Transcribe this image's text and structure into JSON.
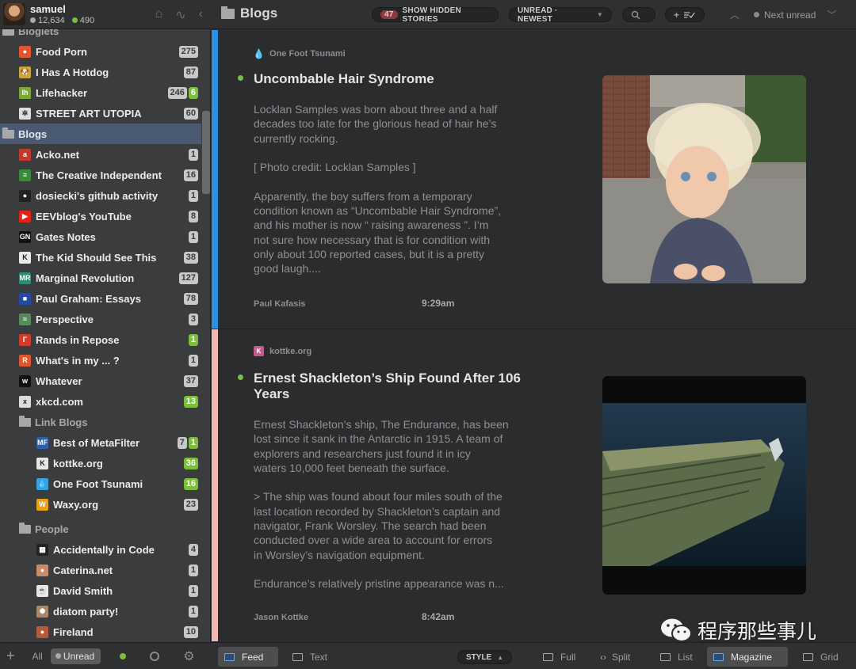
{
  "profile": {
    "name": "samuel",
    "stat_primary": "12,634",
    "stat_secondary": "490"
  },
  "sidebar": {
    "partial_folder": "Blogiets",
    "feeds_top": [
      {
        "title": "Food Porn",
        "counts": [
          {
            "v": "275",
            "k": "g"
          }
        ],
        "fav": "#e4552b",
        "glyph": "●"
      },
      {
        "title": "I Has A Hotdog",
        "counts": [
          {
            "v": "87",
            "k": "g"
          }
        ],
        "fav": "#c9a53a",
        "glyph": "🐶"
      },
      {
        "title": "Lifehacker",
        "counts": [
          {
            "v": "246",
            "k": "g"
          },
          {
            "v": "6",
            "k": "n"
          }
        ],
        "fav": "#7aa83a",
        "glyph": "lh"
      },
      {
        "title": "STREET ART UTOPIA",
        "counts": [
          {
            "v": "60",
            "k": "g"
          }
        ],
        "fav": "#dddddd",
        "glyph": "✲"
      }
    ],
    "blogs_folder": "Blogs",
    "feeds_blogs": [
      {
        "title": "Acko.net",
        "counts": [
          {
            "v": "1",
            "k": "g"
          }
        ],
        "fav": "#c0392b",
        "glyph": "a"
      },
      {
        "title": "The Creative Independent",
        "counts": [
          {
            "v": "16",
            "k": "g"
          }
        ],
        "fav": "#3a8a3a",
        "glyph": "≡"
      },
      {
        "title": "dosiecki's github activity",
        "counts": [
          {
            "v": "1",
            "k": "g"
          }
        ],
        "fav": "#222222",
        "glyph": "●"
      },
      {
        "title": "EEVblog's YouTube",
        "counts": [
          {
            "v": "8",
            "k": "g"
          }
        ],
        "fav": "#e62117",
        "glyph": "▶"
      },
      {
        "title": "Gates Notes",
        "counts": [
          {
            "v": "1",
            "k": "g"
          }
        ],
        "fav": "#111111",
        "glyph": "GN"
      },
      {
        "title": "The Kid Should See This",
        "counts": [
          {
            "v": "38",
            "k": "g"
          }
        ],
        "fav": "#e8e8e8",
        "glyph": "K"
      },
      {
        "title": "Marginal Revolution",
        "counts": [
          {
            "v": "127",
            "k": "g"
          }
        ],
        "fav": "#2e8b6f",
        "glyph": "MR"
      },
      {
        "title": "Paul Graham: Essays",
        "counts": [
          {
            "v": "78",
            "k": "g"
          }
        ],
        "fav": "#2649a5",
        "glyph": "■"
      },
      {
        "title": "Perspective",
        "counts": [
          {
            "v": "3",
            "k": "g"
          }
        ],
        "fav": "#5a8a5a",
        "glyph": "≈"
      },
      {
        "title": "Rands in Repose",
        "counts": [
          {
            "v": "1",
            "k": "n"
          }
        ],
        "fav": "#d23a2a",
        "glyph": "Γ"
      },
      {
        "title": "What's in my ... ?",
        "counts": [
          {
            "v": "1",
            "k": "g"
          }
        ],
        "fav": "#e0562c",
        "glyph": "R"
      },
      {
        "title": "Whatever",
        "counts": [
          {
            "v": "37",
            "k": "g"
          }
        ],
        "fav": "#111111",
        "glyph": "w"
      },
      {
        "title": "xkcd.com",
        "counts": [
          {
            "v": "13",
            "k": "n"
          }
        ],
        "fav": "#dddddd",
        "glyph": "x"
      }
    ],
    "link_blogs_folder": "Link Blogs",
    "feeds_link": [
      {
        "title": "Best of MetaFilter",
        "counts": [
          {
            "v": "7",
            "k": "g"
          },
          {
            "v": "1",
            "k": "n"
          }
        ],
        "fav": "#2f5fa8",
        "glyph": "MF"
      },
      {
        "title": "kottke.org",
        "counts": [
          {
            "v": "36",
            "k": "n"
          }
        ],
        "fav": "#e6e6e6",
        "glyph": "K"
      },
      {
        "title": "One Foot Tsunami",
        "counts": [
          {
            "v": "16",
            "k": "n"
          }
        ],
        "fav": "#3aa0e0",
        "glyph": "💧"
      },
      {
        "title": "Waxy.org",
        "counts": [
          {
            "v": "23",
            "k": "g"
          }
        ],
        "fav": "#e8a21a",
        "glyph": "W"
      }
    ],
    "people_folder": "People",
    "feeds_people": [
      {
        "title": "Accidentally in Code",
        "counts": [
          {
            "v": "4",
            "k": "g"
          }
        ],
        "fav": "#222222",
        "glyph": "▦"
      },
      {
        "title": "Caterina.net",
        "counts": [
          {
            "v": "1",
            "k": "g"
          }
        ],
        "fav": "#c98a6a",
        "glyph": "●"
      },
      {
        "title": "David Smith",
        "counts": [
          {
            "v": "1",
            "k": "g"
          }
        ],
        "fav": "#e8e8e8",
        "glyph": "☕"
      },
      {
        "title": "diatom party!",
        "counts": [
          {
            "v": "1",
            "k": "g"
          }
        ],
        "fav": "#aa8866",
        "glyph": "✺"
      },
      {
        "title": "Fireland",
        "counts": [
          {
            "v": "10",
            "k": "g"
          }
        ],
        "fav": "#b55a3a",
        "glyph": "●"
      }
    ],
    "footer": {
      "all": "All",
      "unread": "Unread"
    }
  },
  "topbar": {
    "title": "Blogs",
    "hidden_count": "47",
    "hidden_label": "SHOW HIDDEN STORIES",
    "order_label": "UNREAD · NEWEST",
    "next_unread": "Next unread"
  },
  "stories": [
    {
      "source": "One Foot Tsunami",
      "title": "Uncombable Hair Syndrome",
      "paragraphs": [
        [
          "Locklan Samples was born about three and a half",
          "decades too late for the glorious head of hair he’s",
          "currently rocking."
        ],
        [
          "[ Photo credit: Locklan Samples ]"
        ],
        [
          "Apparently, the boy suffers from a temporary",
          "condition known as “Uncombable Hair Syndrome”,",
          "and his mother is now “ raising awareness ”. I’m",
          "not sure how necessary that is for condition with",
          "only about 100 reported cases, but it is a pretty",
          "good laugh...."
        ]
      ],
      "author": "Paul Kafasis",
      "time": "9:29am",
      "bar_color": "#2f8fe0"
    },
    {
      "source": "kottke.org",
      "title": "Ernest Shackleton’s Ship Found After 106 Years",
      "paragraphs": [
        [
          "Ernest Shackleton’s ship, The Endurance, has been",
          "lost since it sank in the Antarctic in 1915. A team of",
          "explorers and researchers just found it in icy",
          "waters 10,000 feet beneath the surface."
        ],
        [
          "> The ship was found about four miles south of the",
          "last location recorded by Shackleton’s captain and",
          "navigator, Frank Worsley. The search had been",
          "conducted over a wide area to account for errors",
          "in Worsley’s navigation equipment."
        ],
        [
          "Endurance’s relatively pristine appearance was n..."
        ]
      ],
      "author": "Jason Kottke",
      "time": "8:42am",
      "bar_color": "#f2b8b8"
    }
  ],
  "bottombar": {
    "feed": "Feed",
    "text": "Text",
    "style": "STYLE",
    "full": "Full",
    "split": "Split",
    "list": "List",
    "magazine": "Magazine",
    "grid": "Grid"
  },
  "watermark": "程序那些事儿",
  "colors": {
    "accent_unread": "#7cbf3c",
    "selected_folder": "#4a5a72",
    "active_view": "#4c4d4f"
  }
}
